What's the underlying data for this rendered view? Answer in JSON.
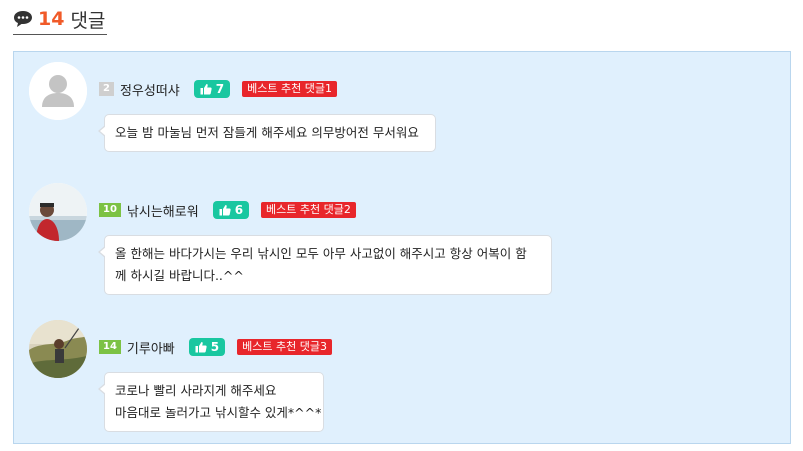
{
  "header": {
    "count": "14",
    "title": "댓글"
  },
  "comments": [
    {
      "level": "2",
      "nickname": "정우성떠샤",
      "likes": "7",
      "best_label": "베스트 추천 댓글1",
      "lines": [
        "오늘 밤 마눌님 먼저 잠들게 해주세요 의무방어전 무서워요"
      ]
    },
    {
      "level": "10",
      "nickname": "낚시는해로워",
      "likes": "6",
      "best_label": "베스트 추천 댓글2",
      "lines": [
        "올 한해는 바다가시는 우리 낚시인 모두 아무 사고없이 해주시고 항상 어복이 함",
        "께 하시길 바랍니다..^^"
      ]
    },
    {
      "level": "14",
      "nickname": "기루아빠",
      "likes": "5",
      "best_label": "베스트 추천 댓글3",
      "lines": [
        "코로나  빨리 사라지게 해주세요",
        "마음대로 놀러가고 낚시할수 있게*^^*"
      ]
    }
  ],
  "colors": {
    "accent": "#f05a28",
    "like": "#19c7a0",
    "best": "#e8262b",
    "panel": "#e0f0fd"
  }
}
